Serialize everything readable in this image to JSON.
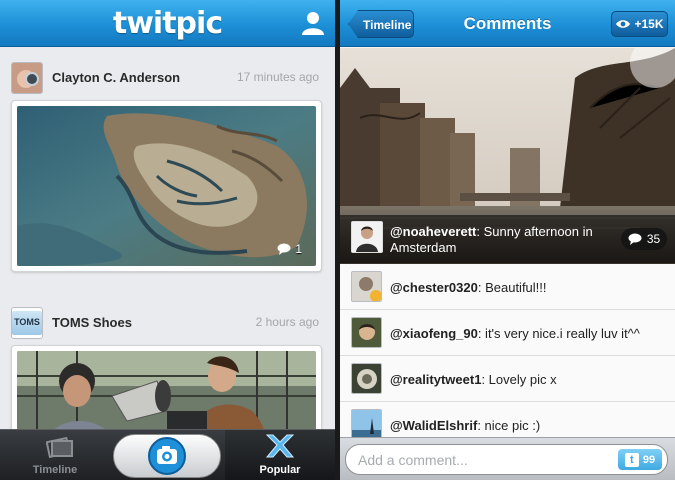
{
  "left": {
    "app_logo": "twitpic",
    "posts": [
      {
        "user": "Clayton C. Anderson",
        "time": "17 minutes ago",
        "comment_count": "1"
      },
      {
        "user": "TOMS Shoes",
        "time": "2 hours ago",
        "avatar_text": "TOMS"
      }
    ],
    "tabs": [
      {
        "label": "Timeline",
        "icon": "photo-stack-icon"
      },
      {
        "label": "",
        "icon": "camera-icon"
      },
      {
        "label": "Popular",
        "icon": "ribbon-x-icon"
      }
    ]
  },
  "right": {
    "back_label": "Timeline",
    "title": "Comments",
    "views": "+15K",
    "caption": {
      "user": "@noaheverett",
      "text": ": Sunny afternoon in Amsterdam",
      "comment_count": "35"
    },
    "comments": [
      {
        "user": "@chester0320",
        "text": ": Beautiful!!!"
      },
      {
        "user": "@xiaofeng_90",
        "text": ": it's very nice.i really luv it^^"
      },
      {
        "user": "@realitytweet1",
        "text": ": Lovely pic x"
      },
      {
        "user": "@WalidElshrif",
        "text": ": nice pic :)"
      }
    ],
    "input_placeholder": "Add a comment...",
    "char_count": "99"
  }
}
